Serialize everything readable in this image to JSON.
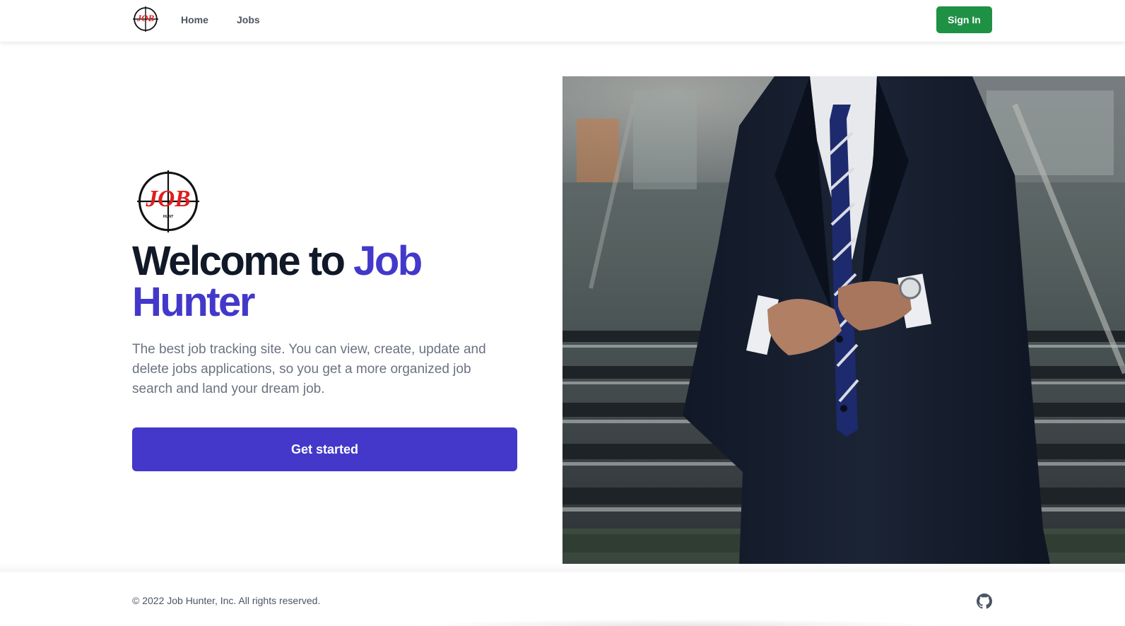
{
  "nav": {
    "home_label": "Home",
    "jobs_label": "Jobs",
    "signin_label": "Sign In",
    "logo_icon": "job-hunt-crosshair-logo"
  },
  "hero": {
    "headline_prefix": "Welcome to ",
    "headline_accent": "Job Hunter",
    "tagline": "The best job tracking site. You can view, create, update and delete jobs applications, so you get a more organized job search and land your dream job.",
    "cta_label": "Get started",
    "logo_text": "JOB",
    "logo_subtext": "HUNT",
    "image": "man in dark suit buttoning jacket on stairs"
  },
  "footer": {
    "copyright": "© 2022 Job Hunter, Inc. All rights reserved.",
    "github_icon": "github-icon"
  },
  "colors": {
    "accent": "#4338ca",
    "signin": "#1f9145",
    "logo_red": "#e11d1d",
    "heading": "#111827",
    "muted": "#6b7280"
  }
}
